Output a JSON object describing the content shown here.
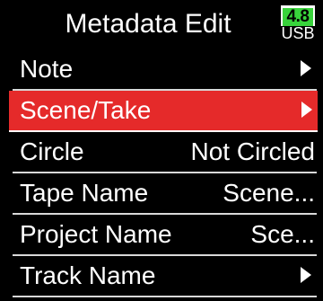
{
  "header": {
    "title": "Metadata Edit",
    "battery_level": "4.8",
    "power_source": "USB"
  },
  "menu": {
    "items": [
      {
        "label": "Note",
        "value": "",
        "icon": "triangle-right-icon"
      },
      {
        "label": "Scene/Take",
        "value": "",
        "icon": "triangle-right-icon"
      },
      {
        "label": "Circle",
        "value": "Not Circled"
      },
      {
        "label": "Tape Name",
        "value": "Scene..."
      },
      {
        "label": "Project Name",
        "value": "Sce..."
      },
      {
        "label": "Track Name",
        "value": "",
        "icon": "triangle-right-icon"
      }
    ]
  },
  "colors": {
    "background": "#000000",
    "selection": "#e52a2a",
    "battery": "#38d33b",
    "text": "#ffffff"
  }
}
